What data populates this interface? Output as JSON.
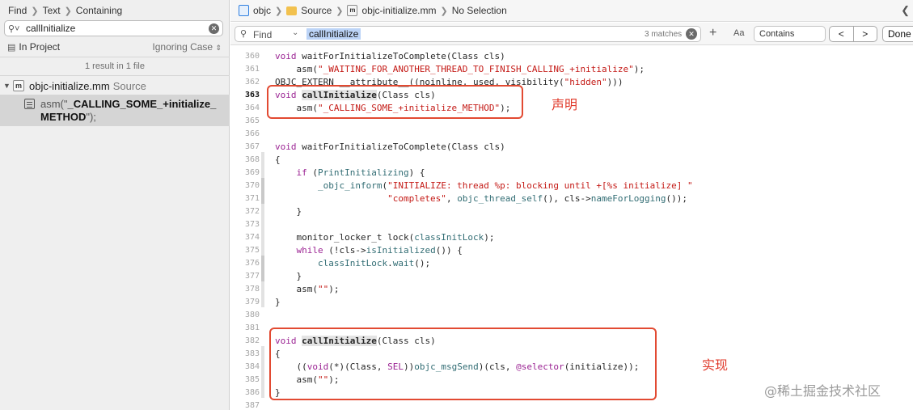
{
  "navigator": {
    "breadcrumb": [
      "Find",
      "Text",
      "Containing"
    ],
    "search_value": "callInitialize",
    "scope": "In Project",
    "case_mode": "Ignoring Case",
    "result_count": "1 result in 1 file",
    "file": {
      "icon_letter": "m",
      "name": "objc-initialize.mm",
      "kind": "Source"
    },
    "match": {
      "prefix": "asm(\"",
      "bold_line1": "_CALLING_SOME_+initialize_",
      "bold_line2": "METHOD",
      "suffix": "\");"
    }
  },
  "jumpbar": {
    "items": [
      "objc",
      "Source",
      "objc-initialize.mm",
      "No Selection"
    ],
    "mm_icon_letter": "m"
  },
  "findbar": {
    "placeholder": "Find",
    "term": "callInitialize",
    "matches": "3 matches",
    "aa": "Aa",
    "mode": "Contains",
    "prev": "<",
    "next": ">",
    "done": "Done"
  },
  "code": {
    "lines": [
      {
        "n": "360",
        "t": [
          [
            "k",
            "void"
          ],
          [
            "",
            "",
            " waitForInitializeToComplete(Class cls)"
          ]
        ]
      },
      {
        "n": "361",
        "t": [
          [
            "",
            "    asm("
          ],
          [
            "s",
            "\"_WAITING_FOR_ANOTHER_THREAD_TO_FINISH_CALLING_+initialize\""
          ],
          [
            "",
            ");"
          ]
        ]
      },
      {
        "n": "362",
        "t": [
          [
            "",
            "OBJC_EXTERN __attribute__((noinline, used, visibility("
          ],
          [
            "s",
            "\"hidden\""
          ],
          [
            "",
            ")))"
          ]
        ]
      },
      {
        "n": "363",
        "cur": true,
        "t": [
          [
            "k",
            "void"
          ],
          [
            "",
            "",
            " "
          ],
          [
            "hl",
            "callInitialize"
          ],
          [
            "",
            "(Class cls)"
          ]
        ]
      },
      {
        "n": "364",
        "t": [
          [
            "",
            "    asm("
          ],
          [
            "s",
            "\"_CALLING_SOME_+initialize_METHOD\""
          ],
          [
            "",
            ");"
          ]
        ]
      },
      {
        "n": "365",
        "t": []
      },
      {
        "n": "366",
        "t": []
      },
      {
        "n": "367",
        "t": [
          [
            "k",
            "void"
          ],
          [
            "",
            "",
            " waitForInitializeToComplete(Class cls)"
          ]
        ]
      },
      {
        "n": "368",
        "t": [
          [
            "",
            "{"
          ]
        ]
      },
      {
        "n": "369",
        "t": [
          [
            "",
            "    "
          ],
          [
            "k",
            "if"
          ],
          [
            "",
            "",
            " ("
          ],
          [
            "f",
            "PrintInitializing"
          ],
          [
            "",
            ") {"
          ]
        ]
      },
      {
        "n": "370",
        "t": [
          [
            "",
            "        "
          ],
          [
            "f",
            "_objc_inform"
          ],
          [
            "",
            "("
          ],
          [
            "s",
            "\"INITIALIZE: thread %p: blocking until +[%s initialize] \""
          ]
        ]
      },
      {
        "n": "371",
        "t": [
          [
            "",
            "                     "
          ],
          [
            "s",
            "\"completes\""
          ],
          [
            "",
            ", "
          ],
          [
            "f",
            "objc_thread_self"
          ],
          [
            "",
            "(), cls->"
          ],
          [
            "f",
            "nameForLogging"
          ],
          [
            "",
            "());"
          ]
        ]
      },
      {
        "n": "372",
        "t": [
          [
            "",
            "    }"
          ]
        ]
      },
      {
        "n": "373",
        "t": []
      },
      {
        "n": "374",
        "t": [
          [
            "",
            "    monitor_locker_t lock("
          ],
          [
            "f",
            "classInitLock"
          ],
          [
            "",
            ");"
          ]
        ]
      },
      {
        "n": "375",
        "t": [
          [
            "",
            "    "
          ],
          [
            "k",
            "while"
          ],
          [
            "",
            "",
            " (!cls->"
          ],
          [
            "f",
            "isInitialized"
          ],
          [
            "",
            "()) {"
          ]
        ]
      },
      {
        "n": "376",
        "t": [
          [
            "",
            "        "
          ],
          [
            "f",
            "classInitLock"
          ],
          [
            "",
            "."
          ],
          [
            "f",
            "wait"
          ],
          [
            "",
            "();"
          ]
        ]
      },
      {
        "n": "377",
        "t": [
          [
            "",
            "    }"
          ]
        ]
      },
      {
        "n": "378",
        "t": [
          [
            "",
            "    asm("
          ],
          [
            "s",
            "\"\""
          ],
          [
            "",
            ");"
          ]
        ]
      },
      {
        "n": "379",
        "t": [
          [
            "",
            "}"
          ]
        ]
      },
      {
        "n": "380",
        "t": []
      },
      {
        "n": "381",
        "t": []
      },
      {
        "n": "382",
        "t": [
          [
            "k",
            "void"
          ],
          [
            "",
            "",
            " "
          ],
          [
            "hl",
            "callInitialize"
          ],
          [
            "",
            "(Class cls)"
          ]
        ]
      },
      {
        "n": "383",
        "t": [
          [
            "",
            "{"
          ]
        ]
      },
      {
        "n": "384",
        "t": [
          [
            "",
            "    (("
          ],
          [
            "k",
            "void"
          ],
          [
            "",
            "(*)(Class, "
          ],
          [
            "k",
            "SEL"
          ],
          [
            "",
            "))"
          ],
          [
            "f",
            "objc_msgSend"
          ],
          [
            "",
            ")(cls, "
          ],
          [
            "k",
            "@selector"
          ],
          [
            "",
            "(initialize));"
          ]
        ]
      },
      {
        "n": "385",
        "t": [
          [
            "",
            "    asm("
          ],
          [
            "s",
            "\"\""
          ],
          [
            "",
            ");"
          ]
        ]
      },
      {
        "n": "386",
        "t": [
          [
            "",
            "}"
          ]
        ]
      },
      {
        "n": "387",
        "t": []
      }
    ]
  },
  "annotations": {
    "declaration_label": "声明",
    "implementation_label": "实现",
    "annotation_color": "#e24a32"
  },
  "watermark": "@稀土掘金技术社区"
}
